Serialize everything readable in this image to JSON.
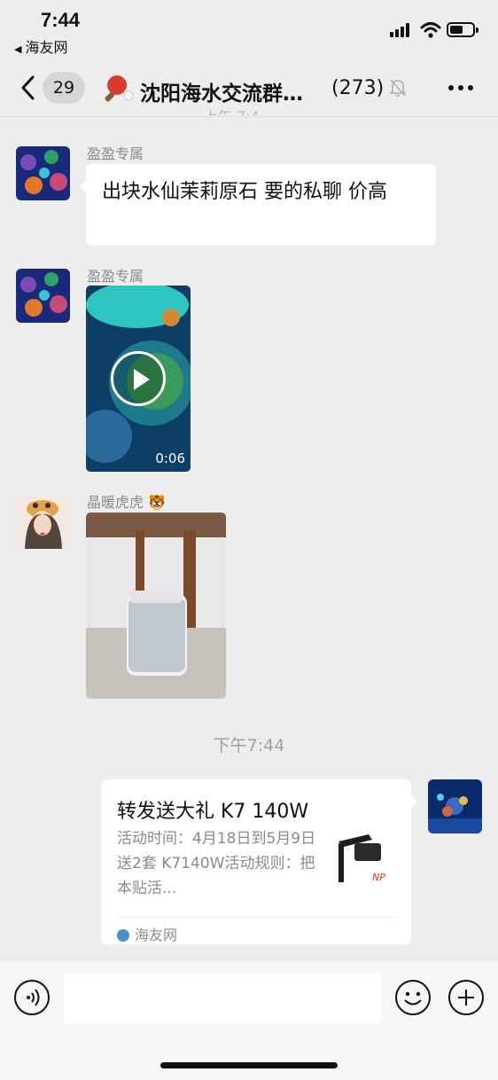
{
  "status_bar": {
    "time": "7:44",
    "back_app": "海友网"
  },
  "nav": {
    "unread_count": "29",
    "group_title": "沈阳海水交流群…",
    "member_count": "(273)"
  },
  "messages": [
    {
      "sender": "盈盈专属",
      "type": "text",
      "text": "出块水仙茉莉原石 要的私聊  价高"
    },
    {
      "sender": "盈盈专属",
      "type": "video",
      "duration": "0:06"
    },
    {
      "sender": "晶暖虎虎 🐯",
      "type": "image"
    }
  ],
  "timestamp": "下午7:44",
  "shared_card": {
    "title": "转发送大礼 K7 140W",
    "description": "活动时间：4月18日到5月9日送2套 K7140W活动规则：把本贴活...",
    "source": "海友网"
  },
  "colors": {
    "background": "#ededed",
    "bubble": "#ffffff",
    "meta_text": "#8a8a8a"
  }
}
